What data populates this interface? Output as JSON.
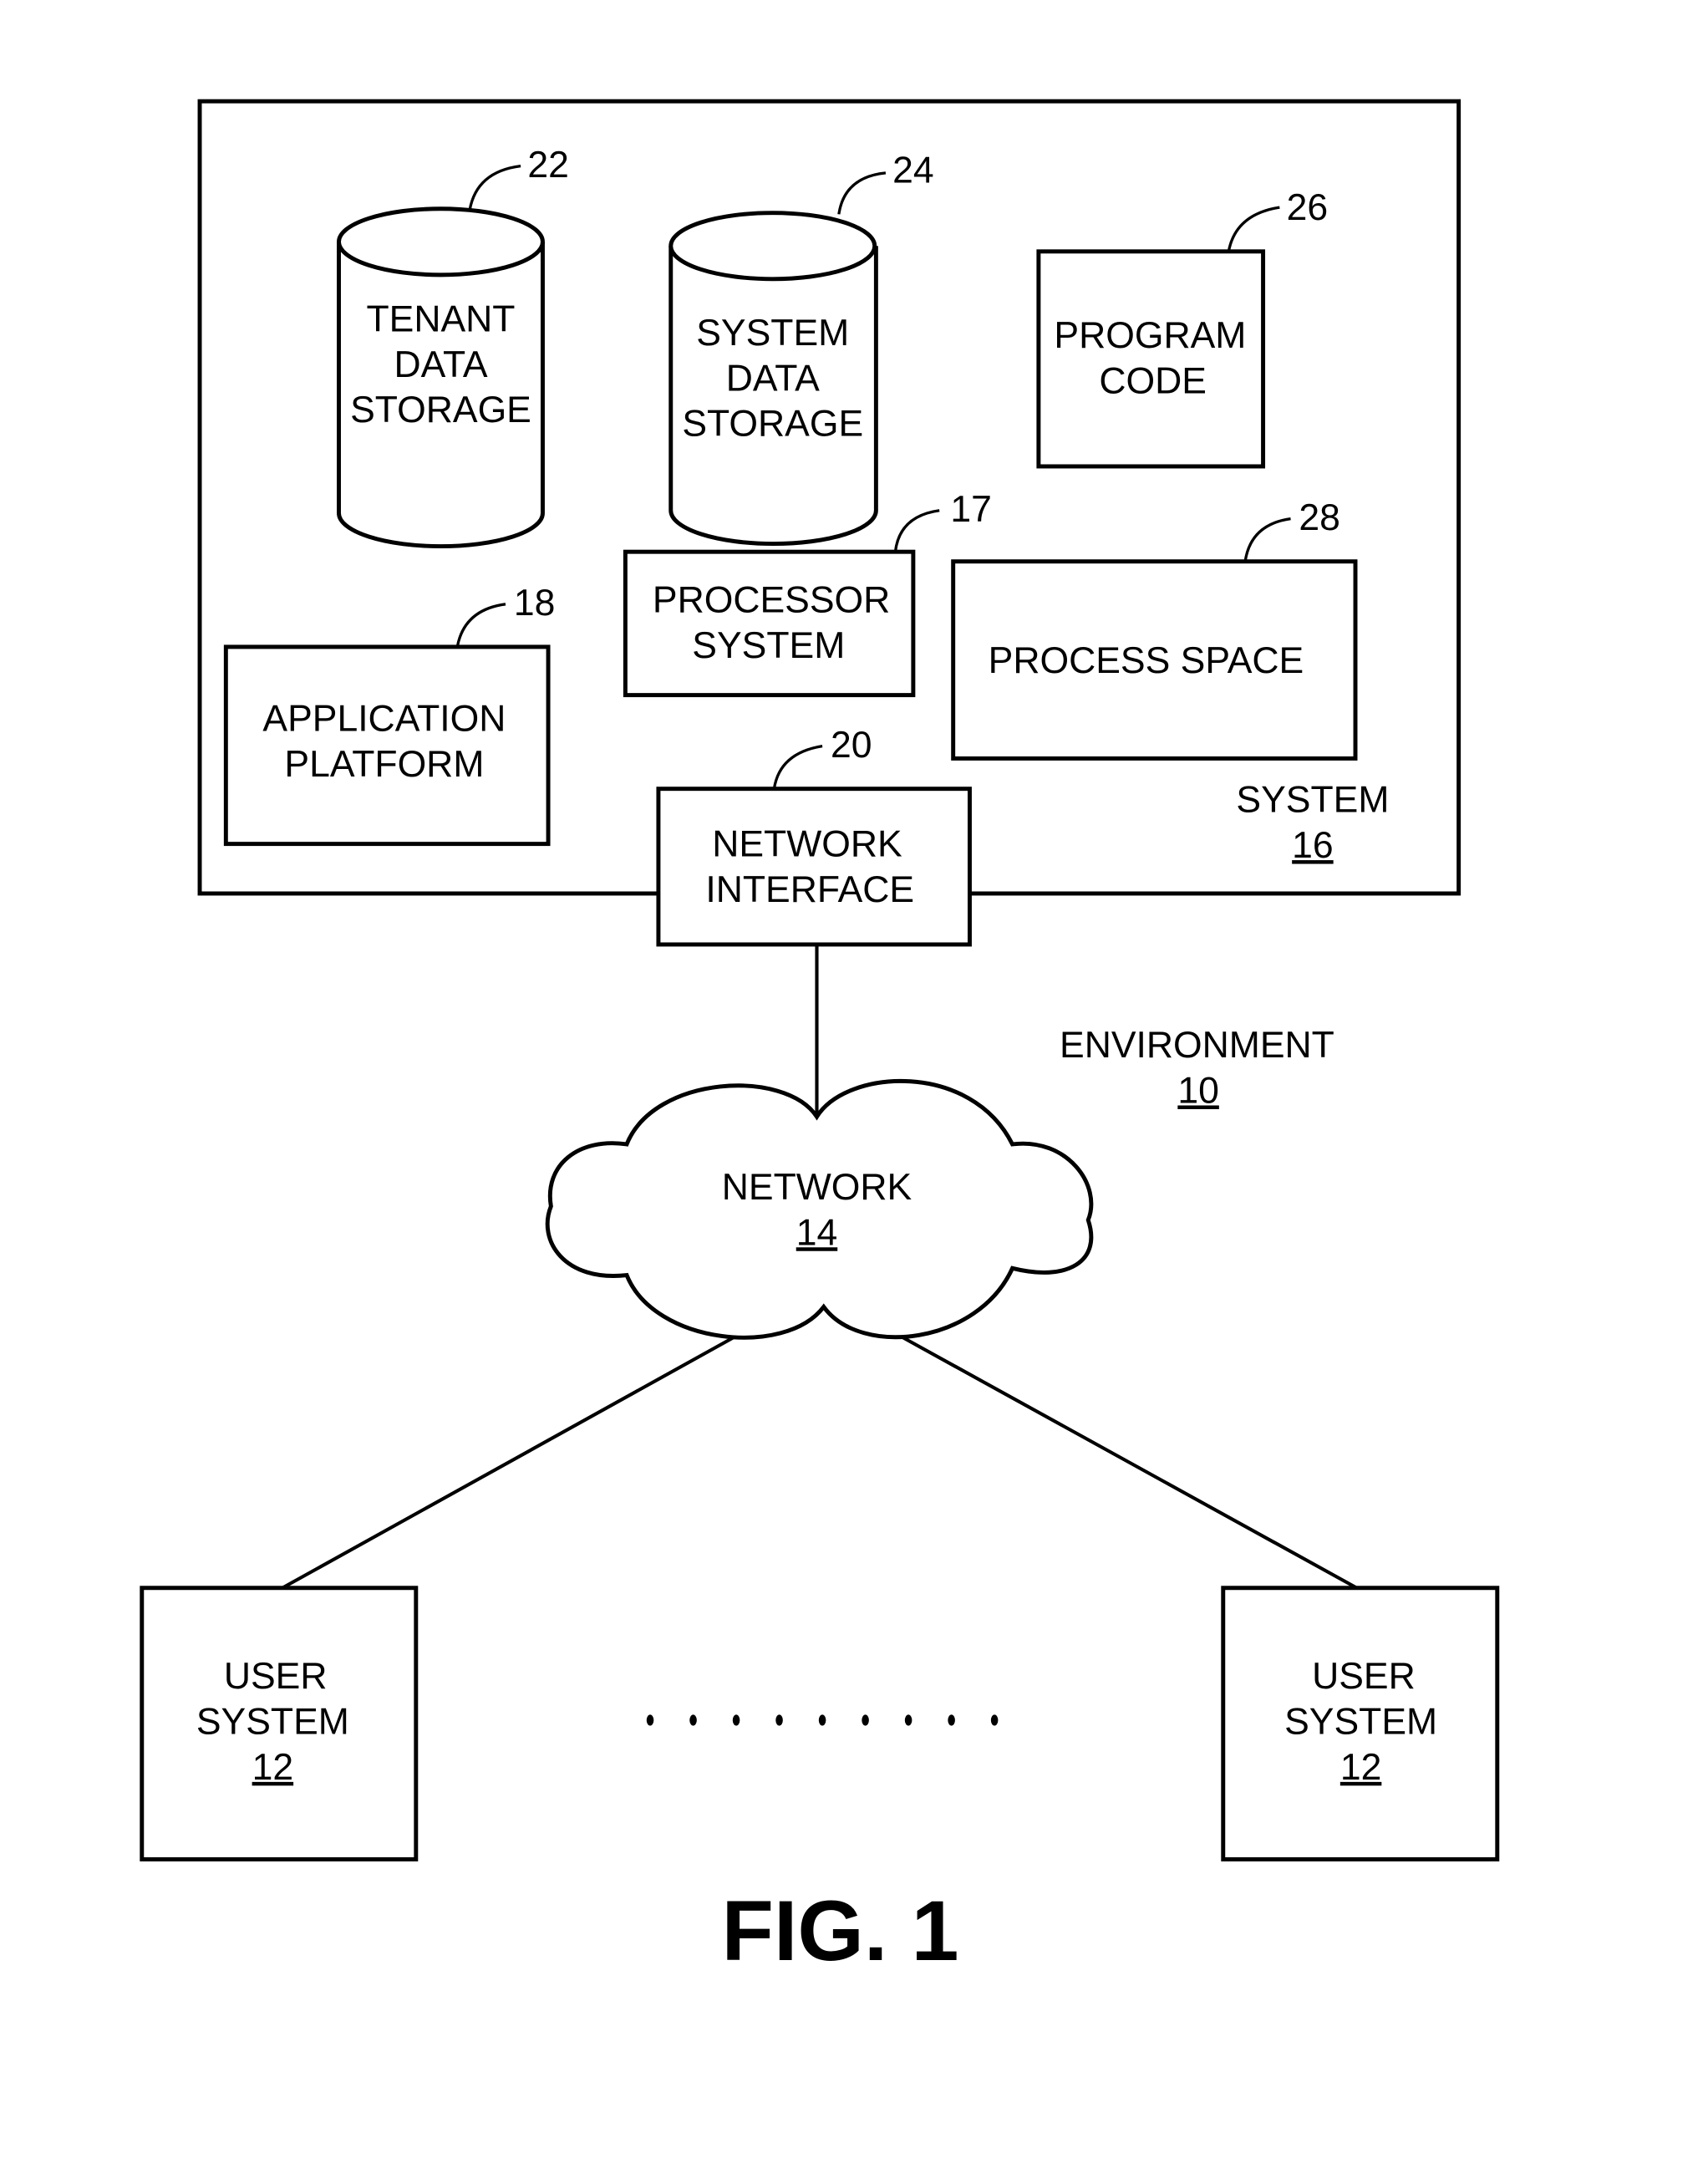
{
  "figure": {
    "title": "FIG. 1",
    "environment": {
      "label": "ENVIRONMENT",
      "ref": "10"
    },
    "system": {
      "label": "SYSTEM",
      "ref": "16",
      "components": {
        "tenant_data_storage": {
          "lines": [
            "TENANT",
            "DATA",
            "STORAGE"
          ],
          "ref": "22",
          "shape": "cylinder"
        },
        "system_data_storage": {
          "lines": [
            "SYSTEM",
            "DATA",
            "STORAGE"
          ],
          "ref": "24",
          "shape": "cylinder"
        },
        "program_code": {
          "lines": [
            "PROGRAM",
            "CODE"
          ],
          "ref": "26",
          "shape": "box"
        },
        "processor_system": {
          "lines": [
            "PROCESSOR",
            "SYSTEM"
          ],
          "ref": "17",
          "shape": "box"
        },
        "process_space": {
          "lines": [
            "PROCESS SPACE"
          ],
          "ref": "28",
          "shape": "box"
        },
        "application_platform": {
          "lines": [
            "APPLICATION",
            "PLATFORM"
          ],
          "ref": "18",
          "shape": "box"
        },
        "network_interface": {
          "lines": [
            "NETWORK",
            "INTERFACE"
          ],
          "ref": "20",
          "shape": "box"
        }
      }
    },
    "network": {
      "label": "NETWORK",
      "ref": "14",
      "shape": "cloud"
    },
    "user_systems": [
      {
        "lines": [
          "USER",
          "SYSTEM"
        ],
        "ref": "12"
      },
      {
        "lines": [
          "USER",
          "SYSTEM"
        ],
        "ref": "12"
      }
    ],
    "ellipsis_dot_count": 9
  }
}
